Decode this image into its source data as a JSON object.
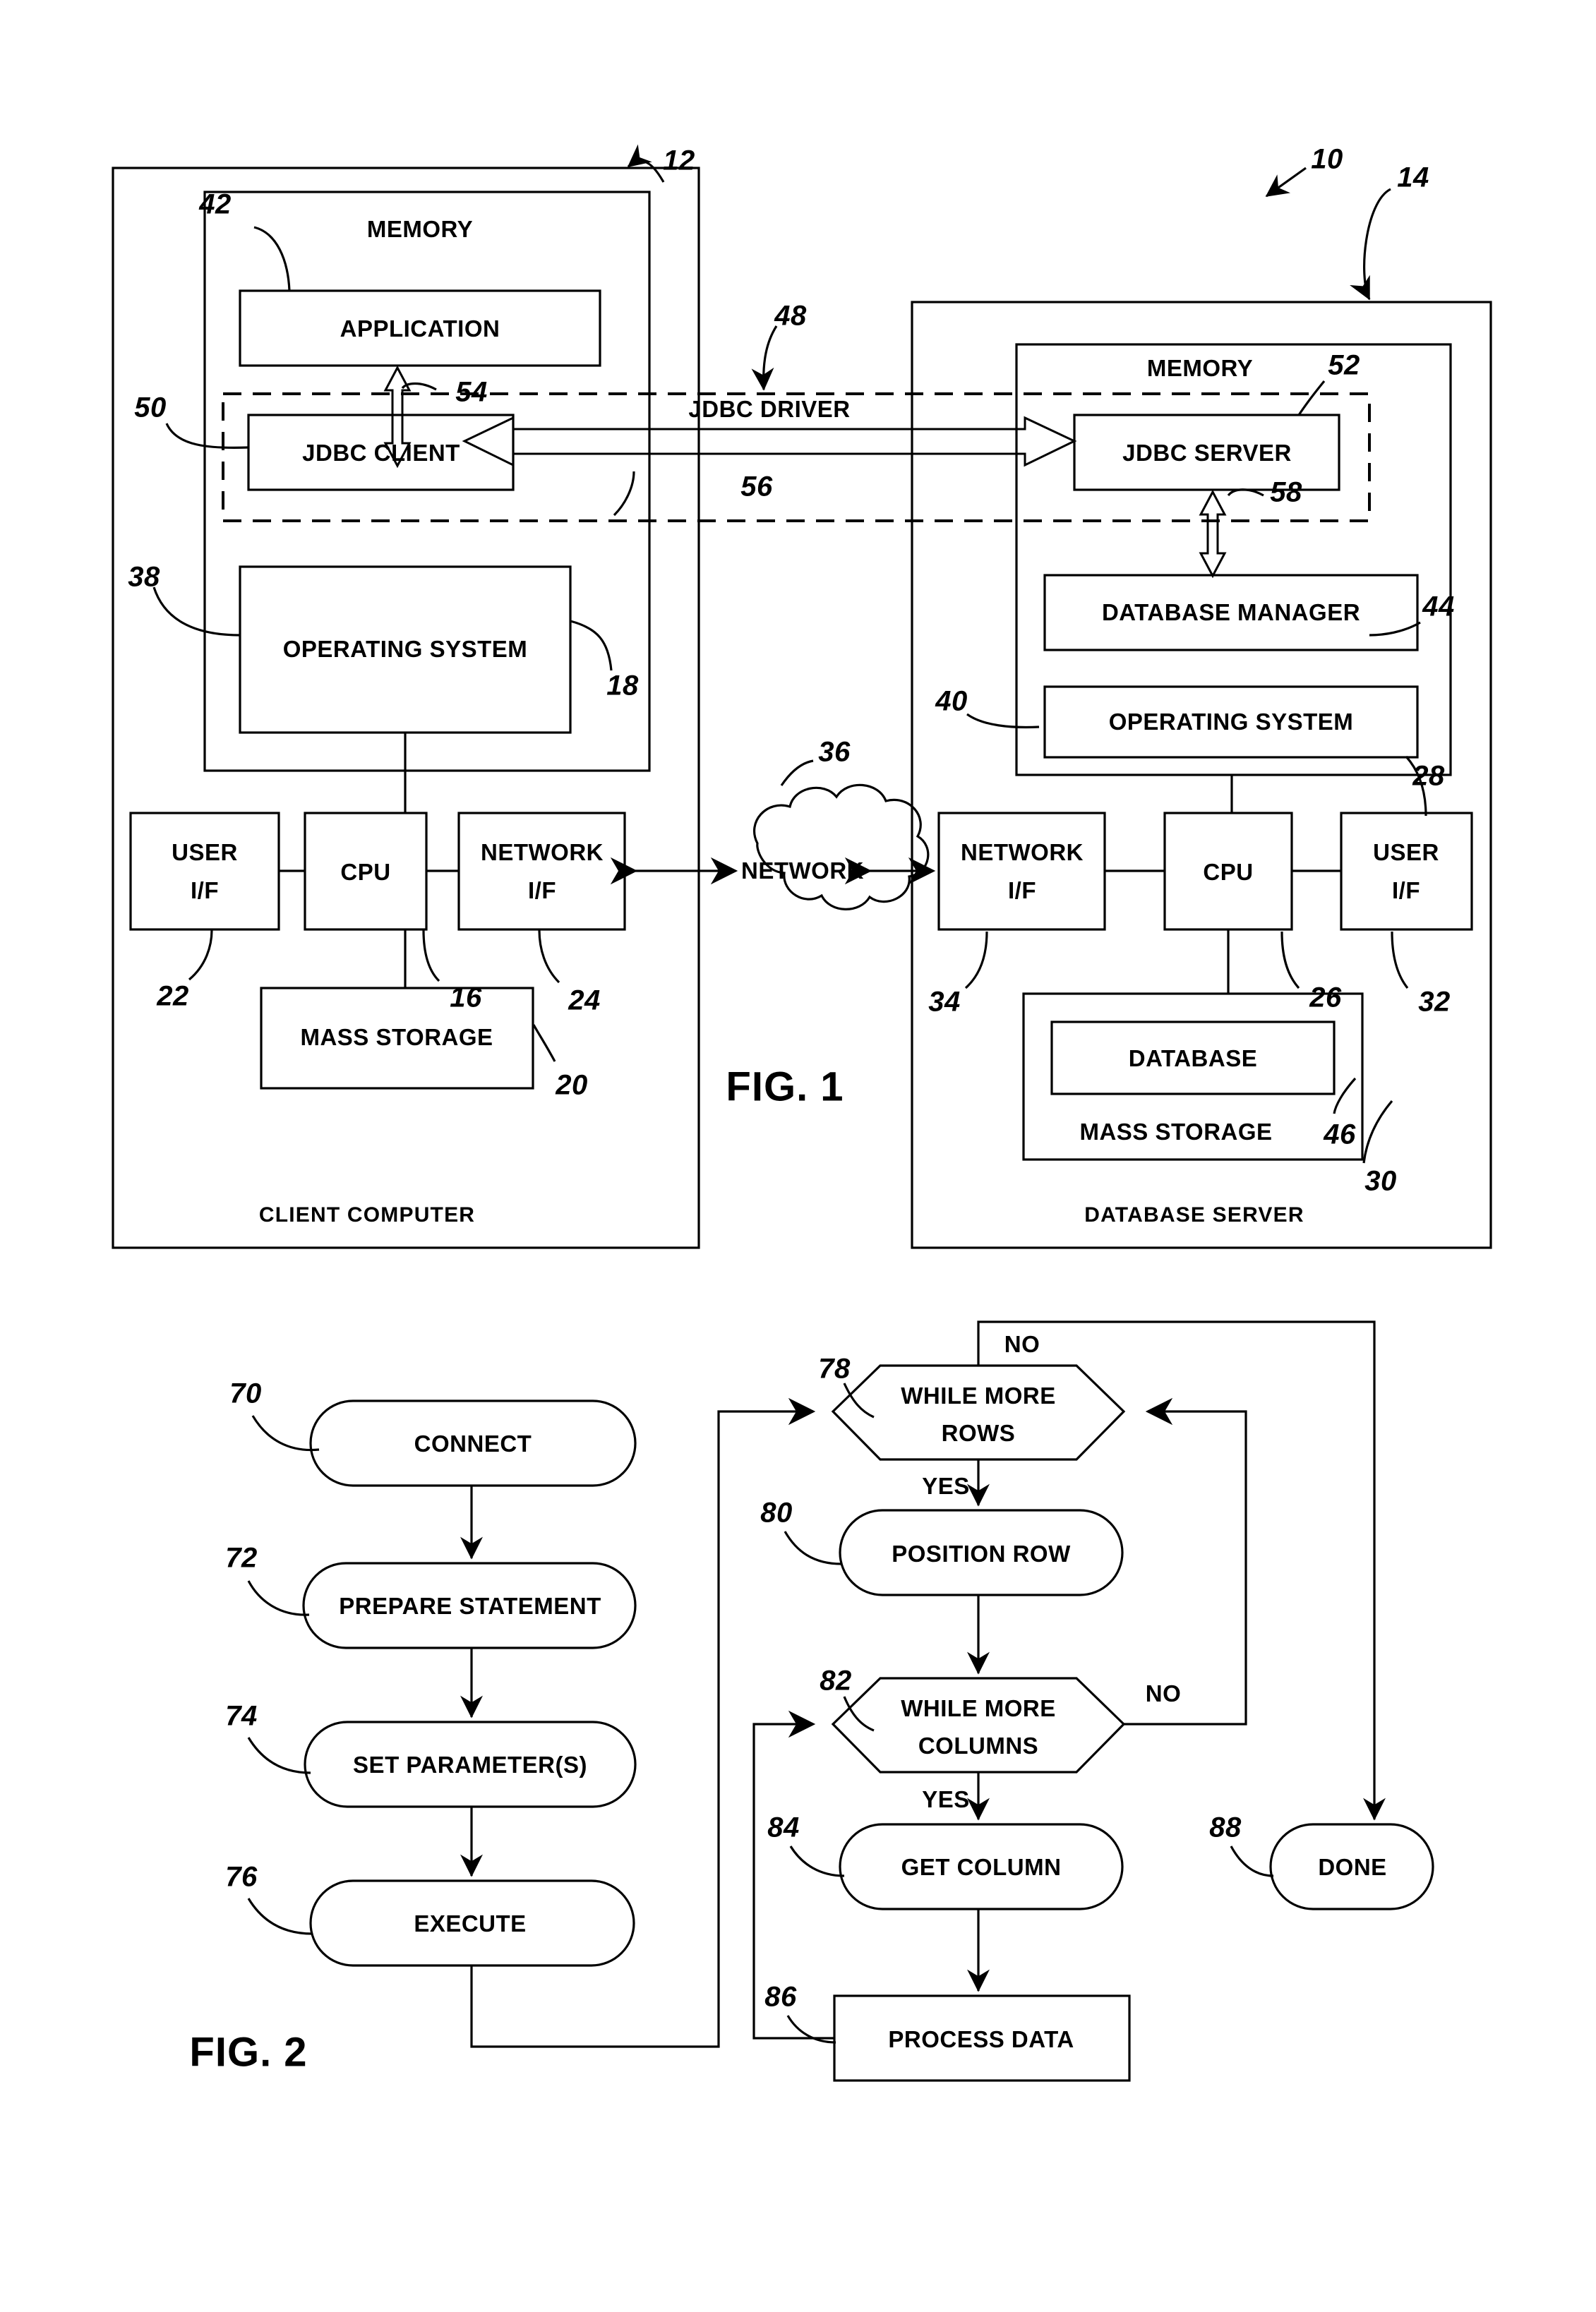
{
  "figures": [
    {
      "id": "fig1",
      "caption": "FIG. 1",
      "system_ref": "10",
      "containers": [
        {
          "name": "CLIENT COMPUTER",
          "ref": "12"
        },
        {
          "name": "DATABASE SERVER",
          "ref": "14"
        }
      ],
      "client": {
        "container_label": "CLIENT COMPUTER",
        "container_ref": "12",
        "memory_label": "MEMORY",
        "memory_ref": "18",
        "blocks": [
          {
            "label": "APPLICATION",
            "ref": "42"
          },
          {
            "label": "JDBC CLIENT",
            "ref": "50"
          },
          {
            "label": "OPERATING SYSTEM",
            "ref": "38"
          },
          {
            "label": "USER I/F",
            "ref": "22",
            "line1": "USER",
            "line2": "I/F"
          },
          {
            "label": "CPU",
            "ref": "16"
          },
          {
            "label": "NETWORK I/F",
            "ref": "24",
            "line1": "NETWORK",
            "line2": "I/F"
          },
          {
            "label": "MASS STORAGE",
            "ref": "20"
          }
        ]
      },
      "server": {
        "container_label": "DATABASE SERVER",
        "container_ref": "14",
        "memory_label": "MEMORY",
        "memory_ref": "28",
        "blocks": [
          {
            "label": "JDBC SERVER",
            "ref": "52"
          },
          {
            "label": "DATABASE MANAGER",
            "ref": "44"
          },
          {
            "label": "OPERATING SYSTEM",
            "ref": "40"
          },
          {
            "label": "NETWORK I/F",
            "ref": "34",
            "line1": "NETWORK",
            "line2": "I/F"
          },
          {
            "label": "CPU",
            "ref": "26"
          },
          {
            "label": "USER I/F",
            "ref": "32",
            "line1": "USER",
            "line2": "I/F"
          },
          {
            "label": "MASS STORAGE",
            "ref": "30"
          },
          {
            "label": "DATABASE",
            "ref": "46"
          }
        ]
      },
      "network": {
        "label": "NETWORK",
        "ref": "36"
      },
      "jdbc_driver": {
        "label": "JDBC DRIVER",
        "ref": "48"
      },
      "connector_refs": [
        {
          "ref": "54",
          "note": "application to jdbc client"
        },
        {
          "ref": "56",
          "note": "jdbc client to jdbc server"
        },
        {
          "ref": "58",
          "note": "jdbc server to database manager"
        }
      ]
    },
    {
      "id": "fig2",
      "caption": "FIG. 2",
      "nodes": [
        {
          "id": "connect",
          "label": "CONNECT",
          "ref": "70",
          "shape": "stadium"
        },
        {
          "id": "prepare",
          "label": "PREPARE STATEMENT",
          "ref": "72",
          "shape": "stadium"
        },
        {
          "id": "setparams",
          "label": "SET PARAMETER(S)",
          "ref": "74",
          "shape": "stadium"
        },
        {
          "id": "execute",
          "label": "EXECUTE",
          "ref": "76",
          "shape": "stadium"
        },
        {
          "id": "morerows",
          "label": "WHILE MORE ROWS",
          "ref": "78",
          "shape": "hexagon",
          "line1": "WHILE MORE",
          "line2": "ROWS"
        },
        {
          "id": "positionrow",
          "label": "POSITION ROW",
          "ref": "80",
          "shape": "stadium"
        },
        {
          "id": "morecolumns",
          "label": "WHILE MORE COLUMNS",
          "ref": "82",
          "shape": "hexagon",
          "line1": "WHILE MORE",
          "line2": "COLUMNS"
        },
        {
          "id": "getcolumn",
          "label": "GET COLUMN",
          "ref": "84",
          "shape": "stadium"
        },
        {
          "id": "processdata",
          "label": "PROCESS DATA",
          "ref": "86",
          "shape": "rect"
        },
        {
          "id": "done",
          "label": "DONE",
          "ref": "88",
          "shape": "stadium"
        }
      ],
      "edge_labels": [
        {
          "from": "morerows",
          "label": "NO",
          "to": "done"
        },
        {
          "from": "morerows",
          "label": "YES",
          "to": "positionrow"
        },
        {
          "from": "morecolumns",
          "label": "NO",
          "to": "morerows"
        },
        {
          "from": "morecolumns",
          "label": "YES",
          "to": "getcolumn"
        }
      ]
    }
  ]
}
